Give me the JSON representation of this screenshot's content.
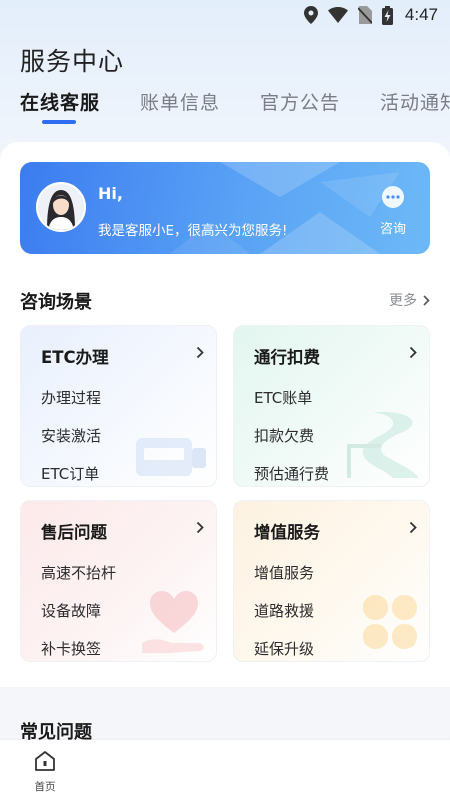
{
  "status_bar": {
    "time": "4:47"
  },
  "page_title": "服务中心",
  "tabs": [
    {
      "label": "在线客服",
      "active": true
    },
    {
      "label": "账单信息",
      "active": false
    },
    {
      "label": "官方公告",
      "active": false
    },
    {
      "label": "活动通知",
      "active": false
    }
  ],
  "banner": {
    "greeting": "Hi,",
    "message": "我是客服小E，很高兴为您服务!",
    "consult_label": "咨询"
  },
  "scenarios": {
    "title": "咨询场景",
    "more_label": "更多",
    "cards": [
      {
        "title": "ETC办理",
        "items": [
          "办理过程",
          "安装激活",
          "ETC订单"
        ]
      },
      {
        "title": "通行扣费",
        "items": [
          "ETC账单",
          "扣款欠费",
          "预估通行费"
        ]
      },
      {
        "title": "售后问题",
        "items": [
          "高速不抬杆",
          "设备故障",
          "补卡换签"
        ]
      },
      {
        "title": "增值服务",
        "items": [
          "增值服务",
          "道路救援",
          "延保升级"
        ]
      }
    ]
  },
  "faq": {
    "title": "常见问题"
  },
  "bottom_nav": {
    "home_label": "首页"
  },
  "colors": {
    "accent": "#2f6df2",
    "banner_start": "#3c7cf0",
    "banner_end": "#6db9f6"
  }
}
